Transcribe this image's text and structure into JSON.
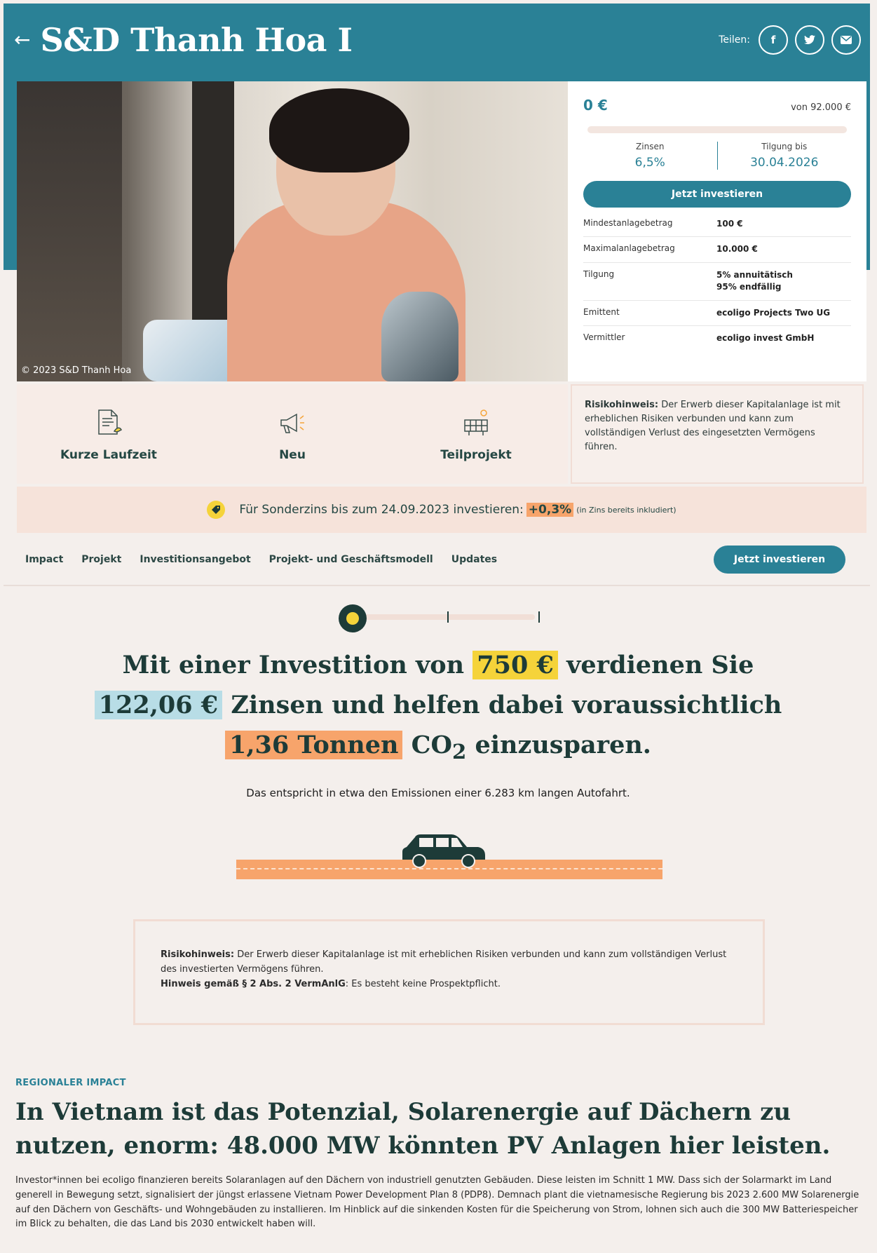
{
  "header": {
    "title": "S&D Thanh Hoa I",
    "share_label": "Teilen:"
  },
  "hero": {
    "caption": "© 2023 S&D Thanh Hoa"
  },
  "card": {
    "amount": "0 €",
    "goal": "von 92.000 €",
    "progress_fraction": 0,
    "interest_label": "Zinsen",
    "interest_value": "6,5%",
    "repayment_label": "Tilgung bis",
    "repayment_value": "30.04.2026",
    "invest_label": "Jetzt investieren",
    "details": [
      {
        "label": "Mindestanlagebetrag",
        "value": "100 €"
      },
      {
        "label": "Maximalanlagebetrag",
        "value": "10.000 €"
      },
      {
        "label": "Tilgung",
        "value": "5% annuitätisch",
        "value2": "95% endfällig"
      },
      {
        "label": "Emittent",
        "value": "ecoligo Projects Two UG"
      },
      {
        "label": "Vermittler",
        "value": "ecoligo invest GmbH"
      }
    ]
  },
  "features": [
    {
      "label": "Kurze Laufzeit",
      "icon": "document-icon"
    },
    {
      "label": "Neu",
      "icon": "megaphone-icon"
    },
    {
      "label": "Teilprojekt",
      "icon": "solar-panel-icon"
    }
  ],
  "risk": {
    "title": "Risikohinweis:",
    "text": " Der Erwerb dieser Kapitalanlage ist mit erheblichen Risiken verbunden und kann zum vollständigen Verlust des eingesetzten Vermögens führen."
  },
  "promo": {
    "text": "Für Sonderzins bis zum 24.09.2023 investieren:",
    "rate": "+0,3%",
    "note": "(in Zins bereits inkludiert)"
  },
  "nav": {
    "items": [
      "Impact",
      "Projekt",
      "Investitionsangebot",
      "Projekt- und Geschäftsmodell",
      "Updates"
    ],
    "button": "Jetzt investieren"
  },
  "calculator": {
    "part1": "Mit einer Investition von",
    "investment": "750 €",
    "part2": "verdienen Sie",
    "interest": "122,06 €",
    "part3": "Zinsen und helfen dabei voraussichtlich",
    "co2": "1,36 Tonnen",
    "co2_label": "CO",
    "co2_sub": "2",
    "part4": "einzusparen.",
    "emission_text": "Das entspricht in etwa den Emissionen einer 6.283 km langen Autofahrt."
  },
  "risk2": {
    "title": "Risikohinweis:",
    "text": " Der Erwerb dieser Kapitalanlage ist mit erheblichen Risiken verbunden und kann zum vollständigen Verlust des investierten Vermögens führen.",
    "hint_title": "Hinweis gemäß § 2 Abs. 2 VermAnlG",
    "hint_text": ": Es besteht keine Prospektpflicht."
  },
  "impact": {
    "eyebrow": "REGIONALER IMPACT",
    "title": "In Vietnam ist das Potenzial, Solarenergie auf Dächern zu nutzen, enorm: 48.000 MW könnten PV Anlagen hier leisten.",
    "text": "Investor*innen bei ecoligo finanzieren bereits Solaranlagen auf den Dächern von industriell genutzten Gebäuden. Diese leisten im Schnitt 1 MW. Dass sich der Solarmarkt im Land generell in Bewegung setzt, signalisiert der jüngst erlassene Vietnam Power Development Plan 8 (PDP8). Demnach plant die vietnamesische Regierung bis 2023 2.600 MW Solarenergie auf den Dächern von Geschäfts- und Wohngebäuden zu installieren. Im Hinblick auf die sinkenden Kosten für die Speicherung von Strom, lohnen sich auch die 300 MW Batteriespeicher im Blick zu behalten, die das Land bis 2030 entwickelt haben will."
  },
  "colors": {
    "teal": "#2a8196",
    "dark": "#1d3b38",
    "yellow": "#f5d33a",
    "orange": "#f7a46b",
    "lightblue": "#b8dde6",
    "background": "#f4efec"
  }
}
